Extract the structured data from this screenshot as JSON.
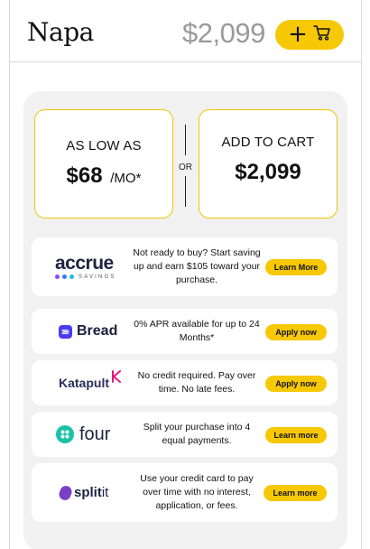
{
  "header": {
    "product_name": "Napa",
    "price": "$2,099",
    "cart_button_icons": [
      "plus-icon",
      "cart-icon"
    ]
  },
  "options": {
    "monthly": {
      "label": "AS LOW AS",
      "amount": "$68",
      "unit": "/MO*"
    },
    "separator": "OR",
    "cart": {
      "label": "ADD TO CART",
      "amount": "$2,099"
    }
  },
  "offers": [
    {
      "brand": "accrue",
      "sub": "SAVINGS",
      "description": "Not ready to buy? Start saving up and earn $105 toward your purchase.",
      "button": "Learn More"
    },
    {
      "brand": "Bread",
      "description": "0% APR available for up to 24 Months*",
      "button": "Apply now"
    },
    {
      "brand": "Katapult",
      "description": "No credit required. Pay over time. No late fees.",
      "button": "Apply now"
    },
    {
      "brand": "four",
      "description": "Split your purchase into 4 equal payments.",
      "button": "Learn more"
    },
    {
      "brand": "split",
      "brand_suffix": "it",
      "description": "Use your credit card to pay over time with no interest, application, or fees.",
      "button": "Learn more"
    }
  ],
  "colors": {
    "accent": "#f6c806",
    "border": "#f1c500",
    "panel": "#f1f1f1"
  }
}
